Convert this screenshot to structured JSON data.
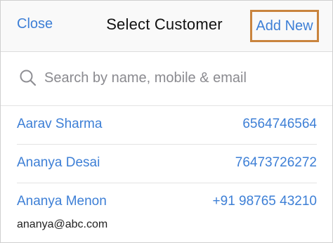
{
  "header": {
    "close_label": "Close",
    "title": "Select Customer",
    "add_new_label": "Add New"
  },
  "search": {
    "placeholder": "Search by name, mobile & email",
    "value": ""
  },
  "customers": [
    {
      "name": "Aarav Sharma",
      "phone": "6564746564"
    },
    {
      "name": "Ananya Desai",
      "phone": "76473726272"
    },
    {
      "name": "Ananya Menon",
      "phone": "+91 98765 43210",
      "email": "ananya@abc.com"
    }
  ],
  "colors": {
    "accent": "#3d7fd6",
    "highlight_border": "#c9843e"
  },
  "icons": {
    "search": "search-icon"
  }
}
